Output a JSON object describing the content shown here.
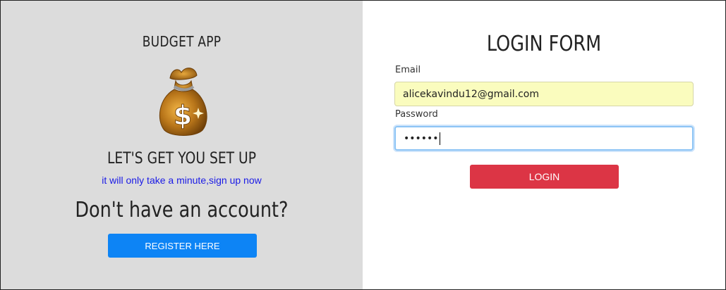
{
  "left": {
    "app_title": "BUDGET APP",
    "setup_title": "LET'S GET YOU SET UP",
    "setup_subtitle": "it will only take a minute,sign up now",
    "no_account": "Don't have an account?",
    "register_label": "REGISTER HERE"
  },
  "login": {
    "title": "LOGIN FORM",
    "email_label": "Email",
    "email_value": "alicekavindu12@gmail.com",
    "password_label": "Password",
    "password_value": "••••••",
    "login_label": "LOGIN"
  },
  "colors": {
    "left_bg": "#dcdcdc",
    "register_button": "#0d84f5",
    "login_button": "#dc3545",
    "subtitle_text": "#1a1ae6",
    "autofill_bg": "#fafcbe"
  },
  "icons": {
    "logo": "money-bag-icon"
  }
}
